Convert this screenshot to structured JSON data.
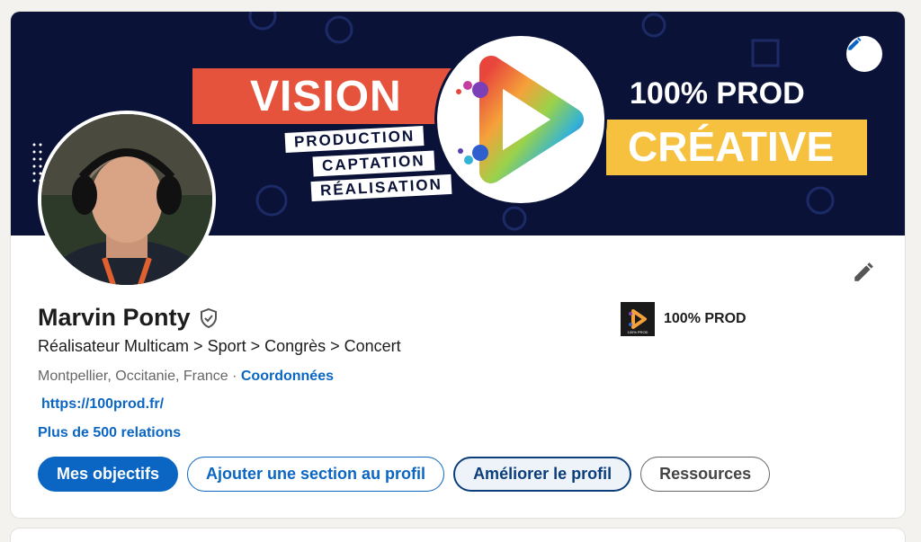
{
  "banner": {
    "vision": "VISION",
    "tags": [
      "PRODUCTION",
      "CAPTATION",
      "RÉALISATION"
    ],
    "prod": "100% PROD",
    "creative": "CRÉATIVE"
  },
  "profile": {
    "name": "Marvin Ponty",
    "headline": "Réalisateur Multicam > Sport > Congrès > Concert",
    "location": "Montpellier, Occitanie, France",
    "separator": " · ",
    "contact_link": "Coordonnées",
    "website": "https://100prod.fr/",
    "relations": "Plus de 500 relations"
  },
  "company": {
    "name": "100% PROD",
    "logo_text": "100% PROD"
  },
  "actions": {
    "goals": "Mes objectifs",
    "add_section": "Ajouter une section au profil",
    "improve": "Améliorer le profil",
    "resources": "Ressources"
  },
  "colors": {
    "primary": "#0a66c2",
    "banner_bg": "#0b1238",
    "vision_red": "#e5533d",
    "creative_yellow": "#f5c13e"
  },
  "icons": {
    "verified": "shield-check-icon",
    "edit": "pencil-icon"
  }
}
